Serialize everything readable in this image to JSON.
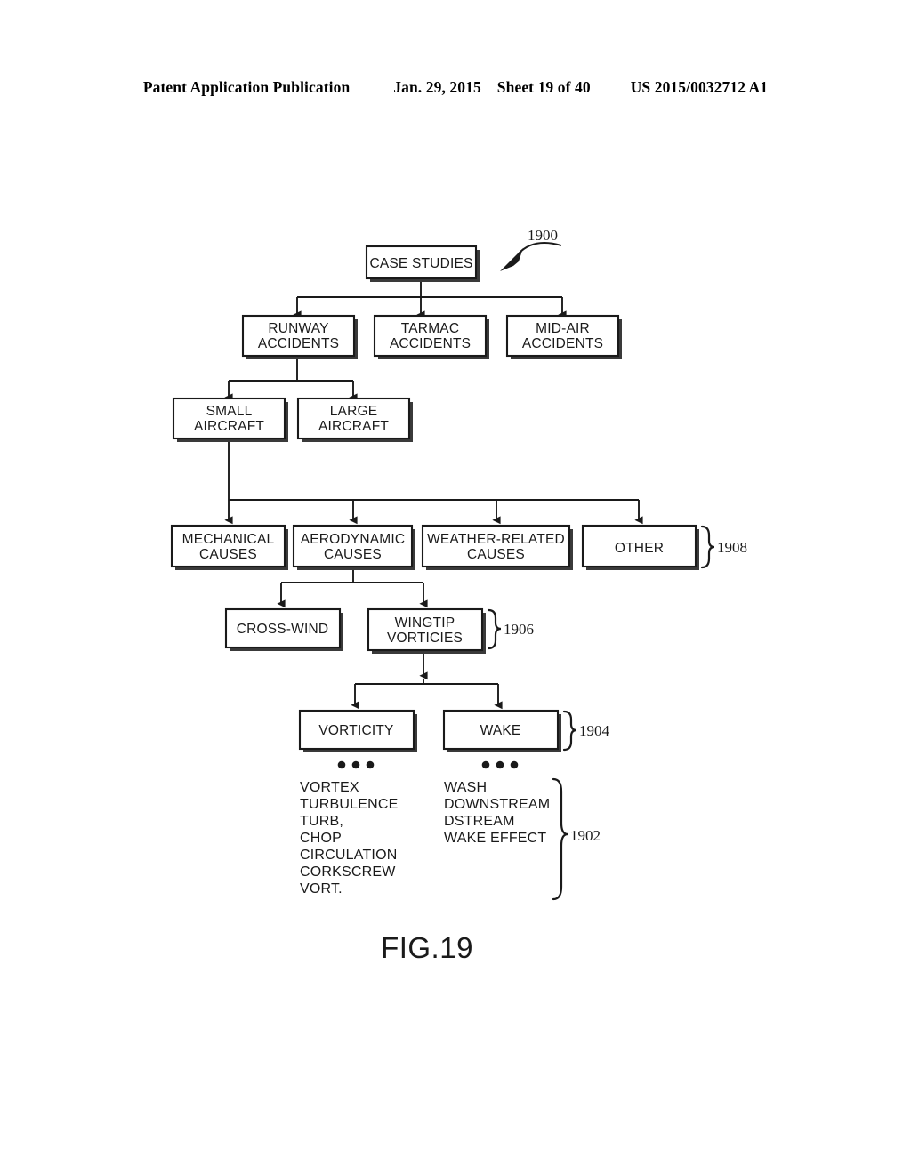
{
  "header": {
    "publication": "Patent Application Publication",
    "date": "Jan. 29, 2015",
    "sheet": "Sheet 19 of 40",
    "pub_number": "US 2015/0032712 A1"
  },
  "figure": {
    "caption": "FIG.19",
    "diagram_type": "hierarchical-tree",
    "root_reference": "1900",
    "nodes": {
      "case_studies": "CASE STUDIES",
      "runway_accidents_line1": "RUNWAY",
      "runway_accidents_line2": "ACCIDENTS",
      "tarmac_accidents_line1": "TARMAC",
      "tarmac_accidents_line2": "ACCIDENTS",
      "midair_accidents_line1": "MID-AIR",
      "midair_accidents_line2": "ACCIDENTS",
      "small_aircraft_line1": "SMALL",
      "small_aircraft_line2": "AIRCRAFT",
      "large_aircraft_line1": "LARGE",
      "large_aircraft_line2": "AIRCRAFT",
      "mechanical_causes_line1": "MECHANICAL",
      "mechanical_causes_line2": "CAUSES",
      "aerodynamic_causes_line1": "AERODYNAMIC",
      "aerodynamic_causes_line2": "CAUSES",
      "weather_causes_line1": "WEATHER-RELATED",
      "weather_causes_line2": "CAUSES",
      "other": "OTHER",
      "cross_wind": "CROSS-WIND",
      "wingtip_vorticies_line1": "WINGTIP",
      "wingtip_vorticies_line2": "VORTICIES",
      "vorticity": "VORTICITY",
      "wake": "WAKE"
    },
    "reference_numerals": {
      "root": "1900",
      "causes_level": "1908",
      "wingtip_level": "1906",
      "vorticity_wake_level": "1904",
      "terms_level": "1902"
    },
    "term_lists": {
      "vorticity_terms": [
        "VORTEX",
        "TURBULENCE",
        "TURB,",
        "CHOP",
        "CIRCULATION",
        "CORKSCREW",
        "VORT."
      ],
      "wake_terms": [
        "WASH",
        "DOWNSTREAM",
        "DSTREAM",
        "WAKE EFFECT"
      ]
    },
    "ellipsis": "• • •"
  },
  "colors": {
    "ink": "#1a1a1a",
    "paper": "#ffffff",
    "shadow": "#3a3a3a"
  }
}
